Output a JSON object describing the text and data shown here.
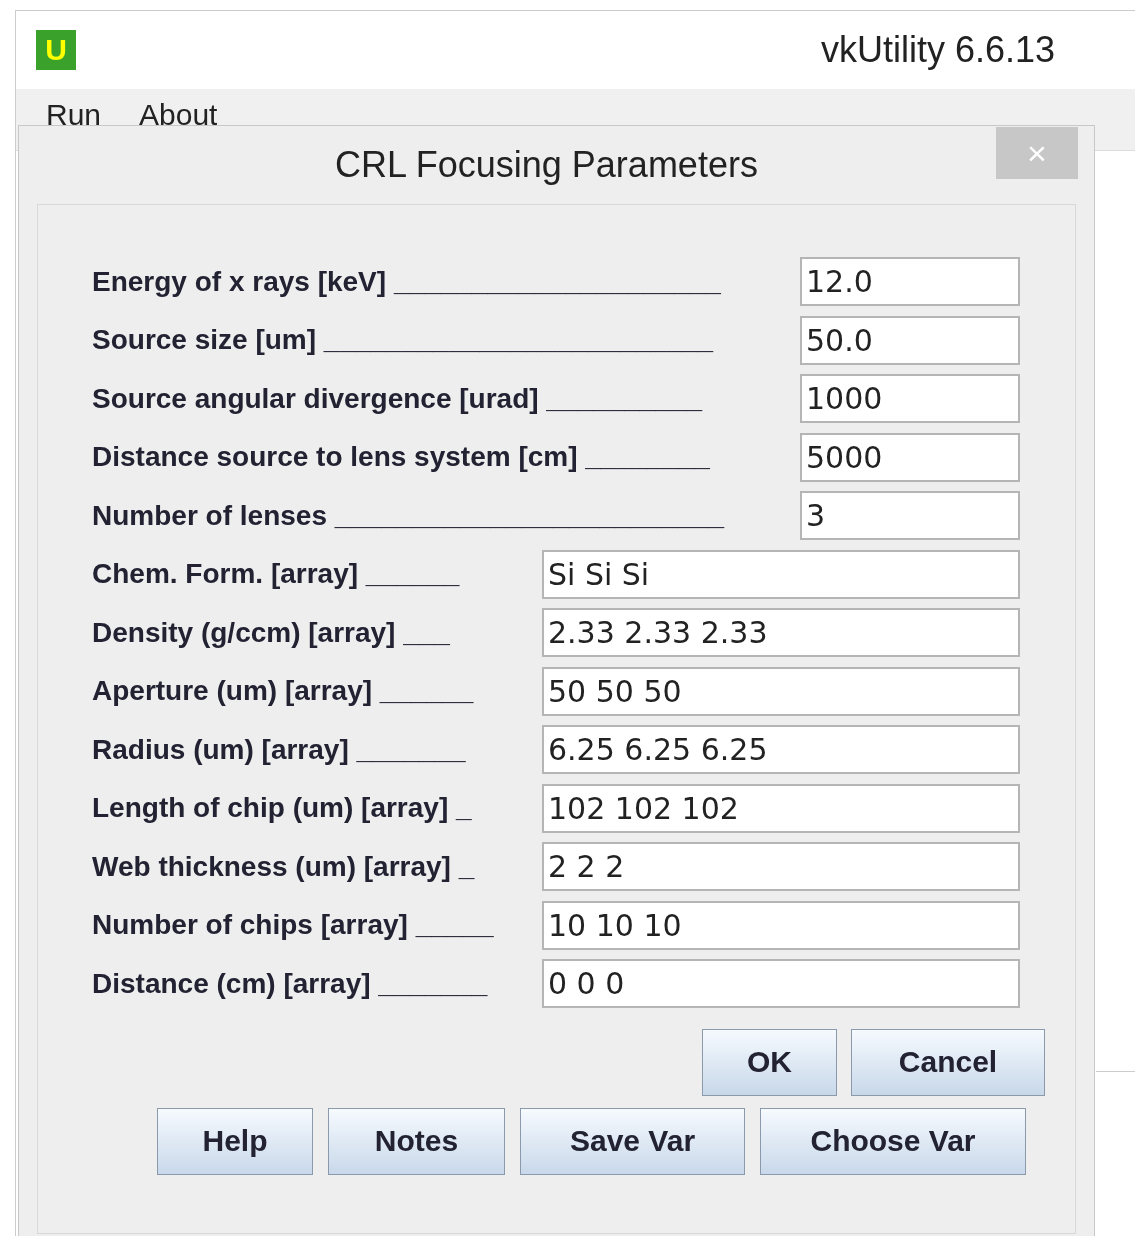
{
  "window": {
    "app_icon": "U",
    "title": "vkUtility 6.6.13"
  },
  "menu": [
    "Run",
    "About"
  ],
  "dialog": {
    "title": "CRL Focusing Parameters",
    "close": "×",
    "fields": [
      {
        "label": "Energy of x rays [keV] _____________________",
        "value": "12.0",
        "kind": "short"
      },
      {
        "label": "Source size [um] _________________________",
        "value": "50.0",
        "kind": "short"
      },
      {
        "label": "Source  angular divergence [urad] __________",
        "value": "1000",
        "kind": "short"
      },
      {
        "label": "Distance source to lens system [cm] ________",
        "value": "5000",
        "kind": "short"
      },
      {
        "label": "Number of lenses _________________________",
        "value": "3",
        "kind": "short"
      },
      {
        "label": "Chem. Form.  [array] ______",
        "value": "Si Si Si",
        "kind": "long"
      },
      {
        "label": "Density (g/ccm)  [array] ___",
        "value": "2.33 2.33 2.33",
        "kind": "long"
      },
      {
        "label": "Aperture (um) [array] ______",
        "value": "50 50 50",
        "kind": "long"
      },
      {
        "label": "Radius (um)  [array] _______",
        "value": "6.25 6.25 6.25",
        "kind": "long"
      },
      {
        "label": "Length of chip (um) [array] _",
        "value": "102 102 102",
        "kind": "long"
      },
      {
        "label": "Web thickness (um) [array] _",
        "value": "2 2 2",
        "kind": "long"
      },
      {
        "label": "Number of chips [array] _____",
        "value": "10 10 10",
        "kind": "long"
      },
      {
        "label": "Distance (cm) [array] _______",
        "value": "0 0 0",
        "kind": "long"
      }
    ],
    "buttons_primary": [
      "OK",
      "Cancel"
    ],
    "buttons_secondary": [
      "Help",
      "Notes",
      "Save Var",
      "Choose Var"
    ]
  }
}
